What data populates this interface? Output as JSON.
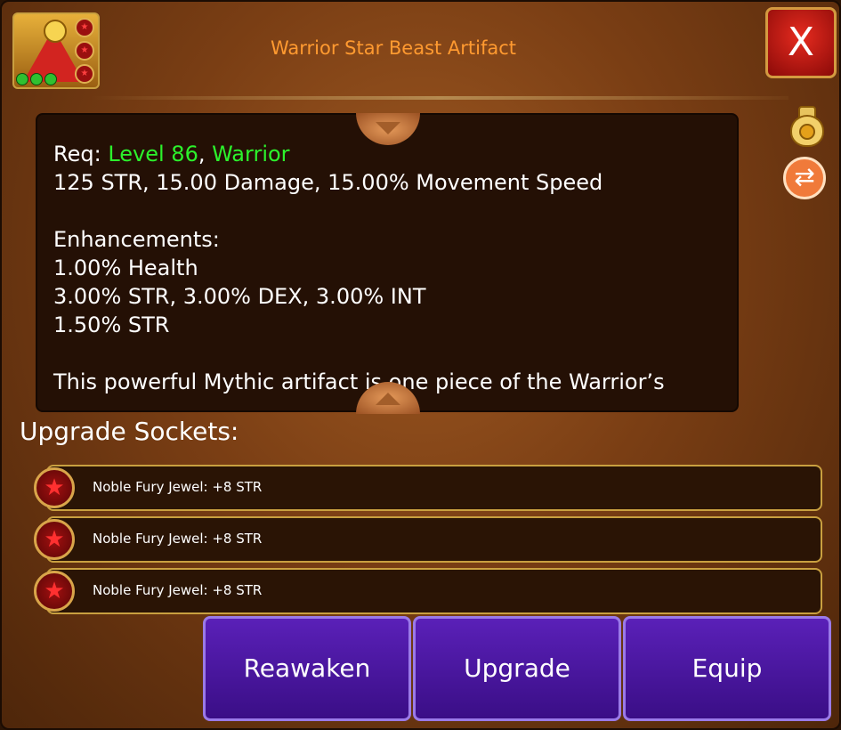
{
  "header": {
    "title": "Warrior Star Beast Artifact",
    "close_label": "X"
  },
  "icons": {
    "item": "warrior-artifact-icon",
    "sell": "coin-bag-icon",
    "swap": "swap-arrows-icon",
    "socket_gem": "red-star-gem-icon"
  },
  "info": {
    "req_prefix": "Req: ",
    "req_level": "Level 86",
    "req_sep": ", ",
    "req_class": "Warrior",
    "stats": "125 STR, 15.00 Damage, 15.00% Movement Speed",
    "enhancements_heading": "Enhancements:",
    "enhancements": [
      "1.00% Health",
      "3.00% STR, 3.00% DEX, 3.00% INT",
      "1.50% STR"
    ],
    "description": "This powerful Mythic artifact is one piece of the Warrior’s"
  },
  "sockets": {
    "heading": "Upgrade Sockets:",
    "items": [
      {
        "label": "Noble Fury Jewel: +8 STR"
      },
      {
        "label": "Noble Fury Jewel: +8 STR"
      },
      {
        "label": "Noble Fury Jewel: +8 STR"
      }
    ]
  },
  "buttons": {
    "reawaken": "Reawaken",
    "upgrade": "Upgrade",
    "equip": "Equip"
  },
  "colors": {
    "title": "#ff9a30",
    "requirement_highlight": "#2cf22c",
    "button_purple": "#4a16a0",
    "close_red": "#c8180f"
  }
}
